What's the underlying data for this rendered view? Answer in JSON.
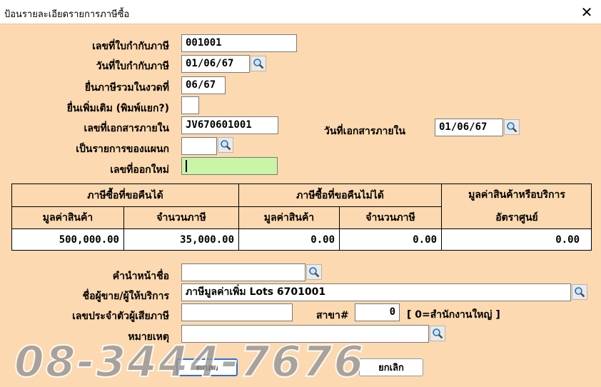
{
  "window": {
    "title": "ป้อนรายละเอียดรายการภาษีซื้อ",
    "close_symbol": "✕"
  },
  "form": {
    "tax_invoice_no": {
      "label": "เลขที่ใบกำกับภาษี",
      "value": "001001"
    },
    "tax_invoice_date": {
      "label": "วันที่ใบกำกับภาษี",
      "value": "01/06/67"
    },
    "filing_period": {
      "label": "ยื่นภาษีรวมในงวดที่",
      "value": "06/67"
    },
    "additional_filing": {
      "label": "ยื่นเพิ่มเติม (พิมพ์แยก?)",
      "value": ""
    },
    "internal_doc_no": {
      "label": "เลขที่เอกสารภายใน",
      "value": "JV670601001"
    },
    "internal_doc_date": {
      "label": "วันที่เอกสารภายใน",
      "value": "01/06/67"
    },
    "department_item": {
      "label": "เป็นรายการของแผนก",
      "value": ""
    },
    "new_issue_no": {
      "label": "เลขที่ออกใหม่",
      "value": ""
    }
  },
  "tax_table": {
    "group_claimable": "ภาษีซื้อที่ขอคืนได้",
    "group_non_claimable": "ภาษีซื้อที่ขอคืนไม่ได้",
    "group_zero_rate_line1": "มูลค่าสินค้าหรือบริการ",
    "group_zero_rate_line2": "อัตราศูนย์",
    "col_goods_value": "มูลค่าสินค้า",
    "col_tax_amount": "จำนวนภาษี",
    "values": {
      "claimable_goods": "500,000.00",
      "claimable_tax": "35,000.00",
      "non_claimable_goods": "0.00",
      "non_claimable_tax": "0.00",
      "zero_rate": "0.00"
    }
  },
  "vendor": {
    "prefix": {
      "label": "คำนำหน้าชื่อ",
      "value": ""
    },
    "name": {
      "label": "ชื่อผู้ขาย/ผู้ให้บริการ",
      "value": "ภาษีมูลค่าเพิ่ม Lots 6701001"
    },
    "tax_id": {
      "label": "เลขประจำตัวผู้เสียภาษี",
      "value": ""
    },
    "branch": {
      "label": "สาขา#",
      "value": "0",
      "hint": "[ 0=สำนักงานใหญ่ ]"
    },
    "remark": {
      "label": "หมายเหตุ",
      "value": ""
    }
  },
  "buttons": {
    "ok": "ตกลง",
    "cancel": "ยกเลิก"
  },
  "watermark": "08-3444-7676"
}
